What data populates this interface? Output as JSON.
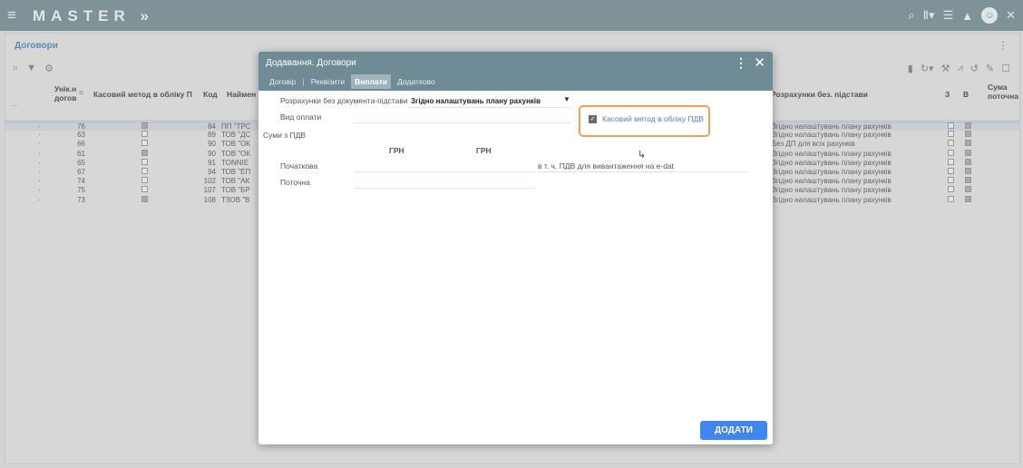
{
  "app": {
    "brand": "MASTER",
    "brand_suffix": "»",
    "menu_icon": "≡",
    "icons": [
      "search-icon",
      "app-switch-icon",
      "list-icon",
      "bell-icon",
      "user-icon",
      "close-icon"
    ]
  },
  "page": {
    "breadcrumb": "Договори",
    "columns": {
      "id": "Унік.н",
      "id2": "догов",
      "cash": "Касовий метод в обліку П",
      "code": "Код",
      "name": "Наймен",
      "settle": "Розрахунки без. підстави",
      "z": "З",
      "v": "В",
      "sum": "Сума",
      "sum2": "поточна"
    },
    "more": "...",
    "rows": [
      {
        "id": "76",
        "cash": true,
        "code": "84",
        "name": "ПП \"ТРС",
        "settle": "Згідно налаштувань плану рахунків",
        "z": false,
        "v": true,
        "selected": true
      },
      {
        "id": "63",
        "cash": false,
        "code": "89",
        "name": "ТОВ \"ДС",
        "settle": "Згідно налаштувань плану рахунків",
        "z": false,
        "v": true,
        "selected": false
      },
      {
        "id": "66",
        "cash": false,
        "code": "90",
        "name": "ТОВ \"ОК",
        "settle": "Без ДП для всіх рахунків",
        "z": false,
        "v": true,
        "selected": false
      },
      {
        "id": "61",
        "cash": true,
        "code": "90",
        "name": "ТОВ \"ОК",
        "settle": "Згідно налаштувань плану рахунків",
        "z": false,
        "v": true,
        "selected": false
      },
      {
        "id": "65",
        "cash": false,
        "code": "91",
        "name": "TONNIE",
        "settle": "Згідно налаштувань плану рахунків",
        "z": false,
        "v": true,
        "selected": false
      },
      {
        "id": "67",
        "cash": false,
        "code": "94",
        "name": "ТОВ \"ЕП",
        "settle": "Згідно налаштувань плану рахунків",
        "z": false,
        "v": true,
        "selected": false
      },
      {
        "id": "74",
        "cash": false,
        "code": "102",
        "name": "ТОВ \"АК",
        "settle": "Згідно налаштувань плану рахунків",
        "z": false,
        "v": true,
        "selected": false
      },
      {
        "id": "75",
        "cash": false,
        "code": "107",
        "name": "ТОВ \"БР",
        "settle": "Згідно налаштувань плану рахунків",
        "z": false,
        "v": true,
        "selected": false
      },
      {
        "id": "73",
        "cash": true,
        "code": "108",
        "name": "ТЗОВ \"В",
        "settle": "Згідно налаштувань плану рахунків",
        "z": false,
        "v": true,
        "selected": false
      }
    ]
  },
  "modal": {
    "title": "Додавання. Договори",
    "tabs": [
      "Договір",
      "Реквізити",
      "Виплати",
      "Додатково"
    ],
    "active_tab": 2,
    "settle_label": "Розрахунки без документа-підстави",
    "settle_value": "Згідно налаштувань плану рахунків",
    "payment_label": "Вид оплати",
    "vat_section": "Суми з ПДВ",
    "cur1": "ГРН",
    "cur2": "ГРН",
    "initial_label": "Початкова",
    "current_label": "Поточна",
    "vat_note": "в т. ч. ПДВ для вивантаження на e-dat",
    "cash_method_label": "Касовий метод в обліку ПДВ",
    "cash_method_checked": true,
    "add_button": "ДОДАТИ"
  },
  "colors": {
    "topbar": "#7e9298",
    "modal_header": "#6f8c96",
    "accent_blue": "#3f86f2",
    "highlight": "#f0a050"
  }
}
